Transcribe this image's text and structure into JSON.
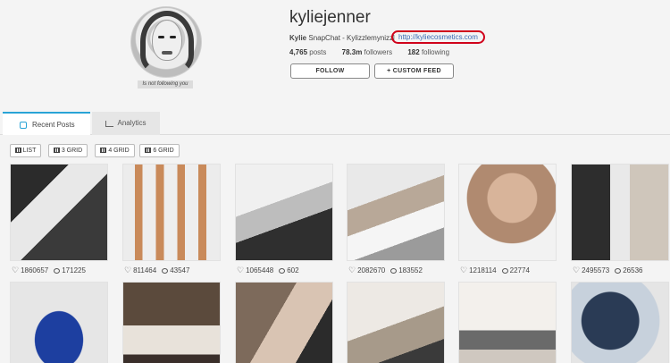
{
  "profile": {
    "username": "kyliejenner",
    "status": "Is not following you",
    "bio_name": "Kylie",
    "bio_text": "SnapChat - Kylizzlemynizzl",
    "bio_link": "http://kyliecosmetics.com",
    "posts_count": "4,765",
    "posts_label": "posts",
    "followers_count": "78.3m",
    "followers_label": "followers",
    "following_count": "182",
    "following_label": "following",
    "follow_label": "FOLLOW",
    "custom_feed_label": "+ CUSTOM FEED"
  },
  "tabs": [
    {
      "label": "Recent Posts",
      "icon": "instagram-icon",
      "active": true
    },
    {
      "label": "Analytics",
      "icon": "chart-icon",
      "active": false
    }
  ],
  "grid_buttons": [
    {
      "label": "LIST",
      "icon": "list-icon"
    },
    {
      "label": "3 GRID",
      "icon": "grid-icon"
    },
    {
      "label": "4 GRID",
      "icon": "grid-icon"
    },
    {
      "label": "6 GRID",
      "icon": "grid-icon"
    }
  ],
  "posts": [
    {
      "likes": "1860657",
      "comments": "171225"
    },
    {
      "likes": "811464",
      "comments": "43547"
    },
    {
      "likes": "1065448",
      "comments": "602"
    },
    {
      "likes": "2082670",
      "comments": "183552"
    },
    {
      "likes": "1218114",
      "comments": "22774"
    },
    {
      "likes": "2495573",
      "comments": "26536"
    },
    {
      "likes": "",
      "comments": ""
    },
    {
      "likes": "",
      "comments": ""
    },
    {
      "likes": "",
      "comments": ""
    },
    {
      "likes": "",
      "comments": ""
    },
    {
      "likes": "",
      "comments": ""
    },
    {
      "likes": "",
      "comments": ""
    }
  ],
  "colors": {
    "accent": "#29a3d6",
    "highlight": "#d0021b",
    "link": "#3b6bb5"
  }
}
